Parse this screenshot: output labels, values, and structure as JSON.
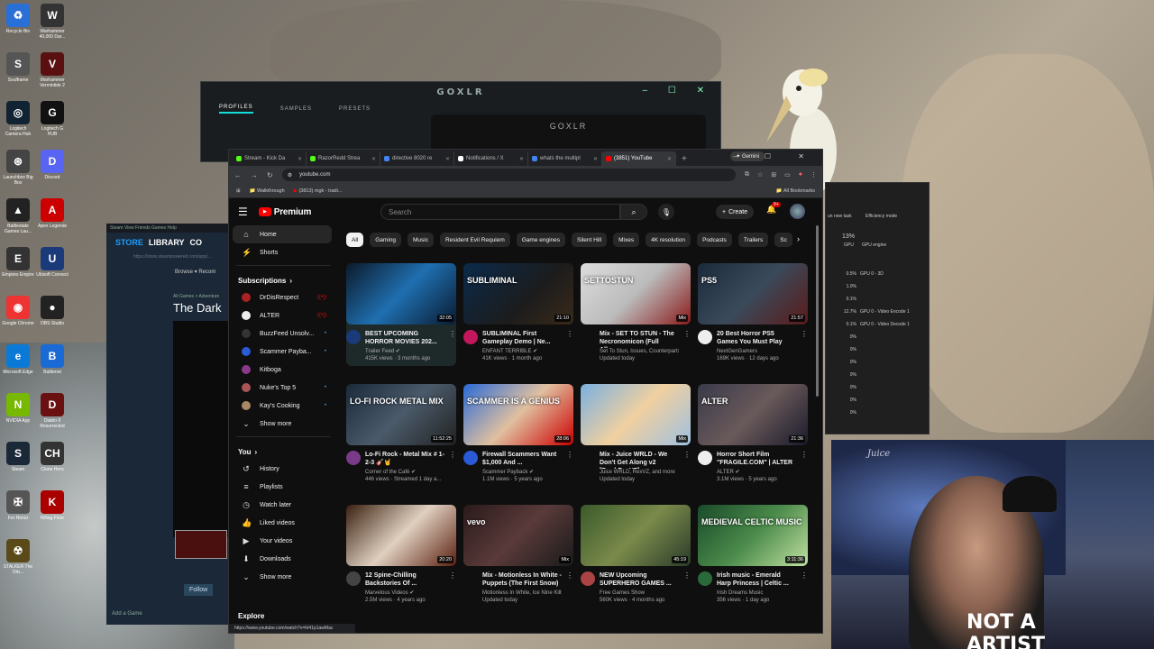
{
  "desktop": {
    "icons": [
      {
        "label": "Recycle Bin",
        "color": "#2a6fd6",
        "glyph": "♻"
      },
      {
        "label": "Warhammer 40,000 Dar...",
        "color": "#333",
        "glyph": "W"
      },
      {
        "label": "Soulframe",
        "color": "#555",
        "glyph": "S"
      },
      {
        "label": "Warhammer Vermintide 2",
        "color": "#5a1010",
        "glyph": "V"
      },
      {
        "label": "Logitech Camera Hub",
        "color": "#123",
        "glyph": "◎"
      },
      {
        "label": "Logitech G HUB",
        "color": "#111",
        "glyph": "G"
      },
      {
        "label": "Launchbox Big Box",
        "color": "#444",
        "glyph": "⊛"
      },
      {
        "label": "Discord",
        "color": "#5865f2",
        "glyph": "D"
      },
      {
        "label": "Battlestate Games Lau...",
        "color": "#222",
        "glyph": "▲"
      },
      {
        "label": "Apex Legends",
        "color": "#c00",
        "glyph": "A"
      },
      {
        "label": "Empires Empire",
        "color": "#333",
        "glyph": "E"
      },
      {
        "label": "Ubisoft Connect",
        "color": "#1a3a7a",
        "glyph": "U"
      },
      {
        "label": "Google Chrome",
        "color": "#e33",
        "glyph": "◉"
      },
      {
        "label": "OBS Studio",
        "color": "#222",
        "glyph": "●"
      },
      {
        "label": "Microsoft Edge",
        "color": "#0a7ad6",
        "glyph": "e"
      },
      {
        "label": "Battlenet",
        "color": "#1a6ad6",
        "glyph": "B"
      },
      {
        "label": "NVIDIA App",
        "color": "#76b900",
        "glyph": "N"
      },
      {
        "label": "Diablo II Resurrected",
        "color": "#6a1010",
        "glyph": "D"
      },
      {
        "label": "Steam",
        "color": "#1b2838",
        "glyph": "S"
      },
      {
        "label": "Clone Hero",
        "color": "#333",
        "glyph": "CH"
      },
      {
        "label": "For Honor",
        "color": "#555",
        "glyph": "✠"
      },
      {
        "label": "Killing Floor",
        "color": "#a00",
        "glyph": "K"
      },
      {
        "label": "STALKER The Orb...",
        "color": "#5a4a1a",
        "glyph": "☢"
      }
    ]
  },
  "goxlr": {
    "title": "GOXLR",
    "tabs": [
      "PROFILES",
      "SAMPLES",
      "PRESETS"
    ],
    "device_label": "GOXLR"
  },
  "steam": {
    "menu": "Steam   View   Friends   Games   Help",
    "nav": [
      "STORE",
      "LIBRARY",
      "CO"
    ],
    "url": "https://store.steampowered.com/app/...",
    "browse": "Browse ▾     Recom",
    "crumb": "All Games > Adventure",
    "game_title": "The Dark",
    "follow": "Follow",
    "add_game": "Add a Game"
  },
  "taskmgr": {
    "header": "Efficiency mode",
    "runtask": "un new task",
    "gpu_total": "13%",
    "gpu_col": "GPU",
    "gpu_engine": "GPU engine",
    "rows": [
      {
        "pct": "0.5%",
        "engine": "GPU 0 - 3D"
      },
      {
        "pct": "1.0%",
        "engine": ""
      },
      {
        "pct": "0.1%",
        "engine": ""
      },
      {
        "pct": "12.7%",
        "engine": "GPU 0 - Video Encode 1"
      },
      {
        "pct": "0.1%",
        "engine": "GPU 0 - Video Decode 1"
      },
      {
        "pct": "0%",
        "engine": ""
      },
      {
        "pct": "0%",
        "engine": ""
      },
      {
        "pct": "0%",
        "engine": ""
      },
      {
        "pct": "0%",
        "engine": ""
      },
      {
        "pct": "0%",
        "engine": ""
      },
      {
        "pct": "0%",
        "engine": ""
      },
      {
        "pct": "0%",
        "engine": ""
      }
    ]
  },
  "webcam": {
    "sign": "Juice",
    "shirt": "NOT A\nARTIST"
  },
  "chrome": {
    "tabs": [
      {
        "label": "Stream - Kick Da",
        "color": "#53fc18",
        "active": false
      },
      {
        "label": "RazorRedd Strea",
        "color": "#53fc18",
        "active": false
      },
      {
        "label": "directive 8020 re",
        "color": "#4285f4",
        "active": false
      },
      {
        "label": "Notifications / X",
        "color": "#ffffff",
        "active": false
      },
      {
        "label": "whats the multipl",
        "color": "#4285f4",
        "active": false
      },
      {
        "label": "(3851) YouTube",
        "color": "#ff0000",
        "active": true
      }
    ],
    "gemini": "✦ Gemini",
    "url": "youtube.com",
    "bookmarks": [
      "Walkthrough",
      "(3813) mgk - tradi..."
    ],
    "all_bookmarks": "All Bookmarks",
    "status_url": "https://www.youtube.com/watch?v=hI41p1awMac"
  },
  "youtube": {
    "logo": "Premium",
    "search_placeholder": "Search",
    "create": "Create",
    "notif_count": "9+",
    "sidebar": {
      "main": [
        {
          "label": "Home",
          "icon": "⌂",
          "active": true
        },
        {
          "label": "Shorts",
          "icon": "⚡",
          "active": false
        }
      ],
      "subs_head": "Subscriptions",
      "subs": [
        {
          "label": "DrDisRespect",
          "color": "#a22",
          "mark": "live"
        },
        {
          "label": "ALTER",
          "color": "#eee",
          "mark": "live"
        },
        {
          "label": "BuzzFeed Unsolv...",
          "color": "#333",
          "mark": "dot"
        },
        {
          "label": "Scammer Payba...",
          "color": "#2a5ad6",
          "mark": "dot"
        },
        {
          "label": "Kitboga",
          "color": "#8a3a8a",
          "mark": ""
        },
        {
          "label": "Nuke's Top 5",
          "color": "#a55",
          "mark": "dot"
        },
        {
          "label": "Kay's Cooking",
          "color": "#a86",
          "mark": "dot"
        },
        {
          "label": "Show more",
          "color": "",
          "mark": ""
        }
      ],
      "you_head": "You",
      "you": [
        {
          "label": "History",
          "icon": "↺"
        },
        {
          "label": "Playlists",
          "icon": "≡"
        },
        {
          "label": "Watch later",
          "icon": "◷"
        },
        {
          "label": "Liked videos",
          "icon": "👍"
        },
        {
          "label": "Your videos",
          "icon": "▶"
        },
        {
          "label": "Downloads",
          "icon": "⬇"
        },
        {
          "label": "Show more",
          "icon": "⌄"
        }
      ],
      "explore": "Explore"
    },
    "chips": [
      "All",
      "Gaming",
      "Music",
      "Resident Evil Requiem",
      "Game engines",
      "Silent Hill",
      "Mixes",
      "4K resolution",
      "Podcasts",
      "Trailers",
      "Sc"
    ],
    "videos": [
      {
        "title": "BEST UPCOMING HORROR MOVIES 202...",
        "channel": "Trailer Feed ✔",
        "stats": "415K views · 3 months ago",
        "duration": "32:05",
        "thumb": "linear-gradient(135deg,#0c1a2a,#1f6fb0 50%,#0a1a30)",
        "overlay": "",
        "av": "#1a3a7a"
      },
      {
        "title": "SUBLIMINAL First Gameplay Demo | Ne...",
        "channel": "ENFANT TERRIBLE ✔",
        "stats": "41K views · 1 month ago",
        "duration": "21:10",
        "thumb": "linear-gradient(135deg,#0a2a4a,#1c1c1c 60%,#3a2a1a)",
        "overlay": "SUBLIMINAL",
        "av": "#c2185b"
      },
      {
        "title": "Mix - SET TO STUN - The Necronomicon (Full Album ...",
        "channel": "Set To Stun, Issues, Counterparts, an...",
        "stats": "Updated today",
        "duration": "Mix",
        "thumb": "linear-gradient(135deg,#ddd,#bbb 50%,#8a1a1a)",
        "overlay": "SETTOSTUN",
        "av": ""
      },
      {
        "title": "20 Best Horror PS5 Games You Must Play",
        "channel": "NextGenGamers",
        "stats": "169K views · 12 days ago",
        "duration": "21:57",
        "thumb": "linear-gradient(135deg,#1a2a3a,#3a4a5a 50%,#5a1a1a)",
        "overlay": "PS5",
        "av": "#eee"
      },
      {
        "title": "Lo-Fi Rock - Metal Mix # 1-2-3 🎸🤘",
        "channel": "Corner of the Café ✔",
        "stats": "446 views · Streamed 1 day a...",
        "duration": "11:52:25",
        "thumb": "linear-gradient(135deg,#1a2a3a,#4a5a6a 50%,#222)",
        "overlay": "LO-FI ROCK METAL MIX",
        "av": "#7a3a8a"
      },
      {
        "title": "Firewall Scammers Want $1,000 And ...",
        "channel": "Scammer Payback ✔",
        "stats": "1.1M views · 5 years ago",
        "duration": "28:06",
        "thumb": "linear-gradient(135deg,#2a6ad6,#e0c0a0 50%,#c00)",
        "overlay": "SCAMMER IS A GENIUS",
        "av": "#2a5ad6"
      },
      {
        "title": "Mix - Juice WRLD - We Don't Get Along v2 [Prod.RexVZ]",
        "channel": "Juice WRLD, RexVZ, and more",
        "stats": "Updated today",
        "duration": "Mix",
        "thumb": "linear-gradient(135deg,#7ab0e0,#f0d0a0 50%,#a0c0e0)",
        "overlay": "",
        "av": ""
      },
      {
        "title": "Horror Short Film \"FRAGILE.COM\" | ALTER",
        "channel": "ALTER ✔",
        "stats": "3.1M views · 5 years ago",
        "duration": "21:36",
        "thumb": "linear-gradient(135deg,#3a3a4a,#6a5a5a 50%,#1a1a2a)",
        "overlay": "ALTER",
        "av": "#eee"
      },
      {
        "title": "12 Spine-Chilling Backstories Of ...",
        "channel": "Marvelous Videos ✔",
        "stats": "2.5M views · 4 years ago",
        "duration": "20:20",
        "thumb": "linear-gradient(135deg,#3a2010,#e0d0c0 50%,#5a2010)",
        "overlay": "",
        "av": "#444"
      },
      {
        "title": "Mix - Motionless In White - Puppets (The First Snow)",
        "channel": "Motionless In White, Ice Nine Kills, Ch...",
        "stats": "Updated today",
        "duration": "Mix",
        "thumb": "linear-gradient(135deg,#2a1a1a,#5a3a3a 50%,#1a1a1a)",
        "overlay": "vevo",
        "av": ""
      },
      {
        "title": "NEW Upcoming SUPERHERO GAMES ...",
        "channel": "Free Games Show",
        "stats": "560K views · 4 months ago",
        "duration": "45:19",
        "thumb": "linear-gradient(135deg,#3a5a2a,#7a8a4a 50%,#2a3a2a)",
        "overlay": "",
        "av": "#a44"
      },
      {
        "title": "Irish music - Emerald Harp Princess | Celtic ...",
        "channel": "Irish Dreams Music",
        "stats": "356 views · 1 day ago",
        "duration": "3:11:36",
        "thumb": "linear-gradient(135deg,#1a4a2a,#4a8a4a 50%,#c0e0a0)",
        "overlay": "MEDIEVAL CELTIC MUSIC",
        "av": "#2a6a3a"
      }
    ]
  }
}
